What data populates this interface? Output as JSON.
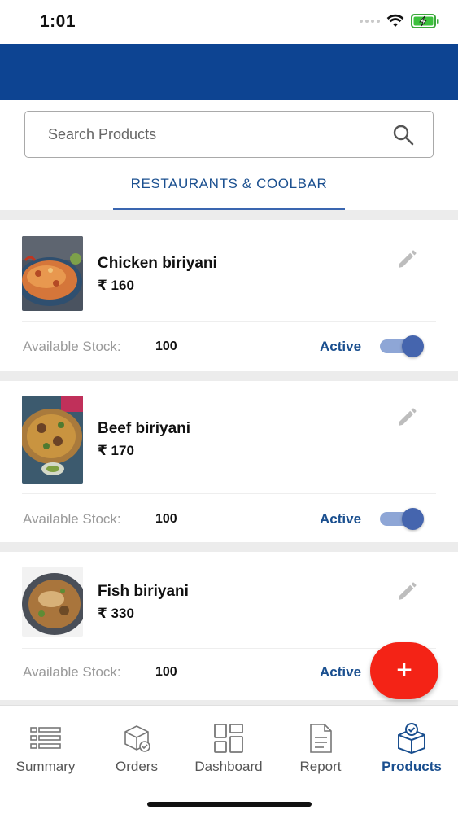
{
  "status_bar": {
    "time": "1:01"
  },
  "search": {
    "placeholder": "Search Products"
  },
  "tabs": [
    {
      "label": "RESTAURANTS & COOLBAR",
      "active": true
    }
  ],
  "products": [
    {
      "name": "Chicken biriyani",
      "price": "₹ 160",
      "stock_label": "Available Stock:",
      "stock": "100",
      "status": "Active",
      "enabled": true
    },
    {
      "name": "Beef biriyani",
      "price": "₹ 170",
      "stock_label": "Available Stock:",
      "stock": "100",
      "status": "Active",
      "enabled": true
    },
    {
      "name": "Fish biriyani",
      "price": "₹ 330",
      "stock_label": "Available Stock:",
      "stock": "100",
      "status": "Active",
      "enabled": true
    }
  ],
  "fab": {
    "symbol": "+"
  },
  "bottom_nav": [
    {
      "label": "Summary",
      "icon": "list-icon",
      "active": false
    },
    {
      "label": "Orders",
      "icon": "box-icon",
      "active": false
    },
    {
      "label": "Dashboard",
      "icon": "grid-icon",
      "active": false
    },
    {
      "label": "Report",
      "icon": "document-icon",
      "active": false
    },
    {
      "label": "Products",
      "icon": "package-icon",
      "active": true
    }
  ],
  "colors": {
    "primary": "#0d4492",
    "accent": "#1a4f8f",
    "fab": "#f42316",
    "toggle_track": "#8ea6d6",
    "toggle_knob": "#4565ae"
  }
}
